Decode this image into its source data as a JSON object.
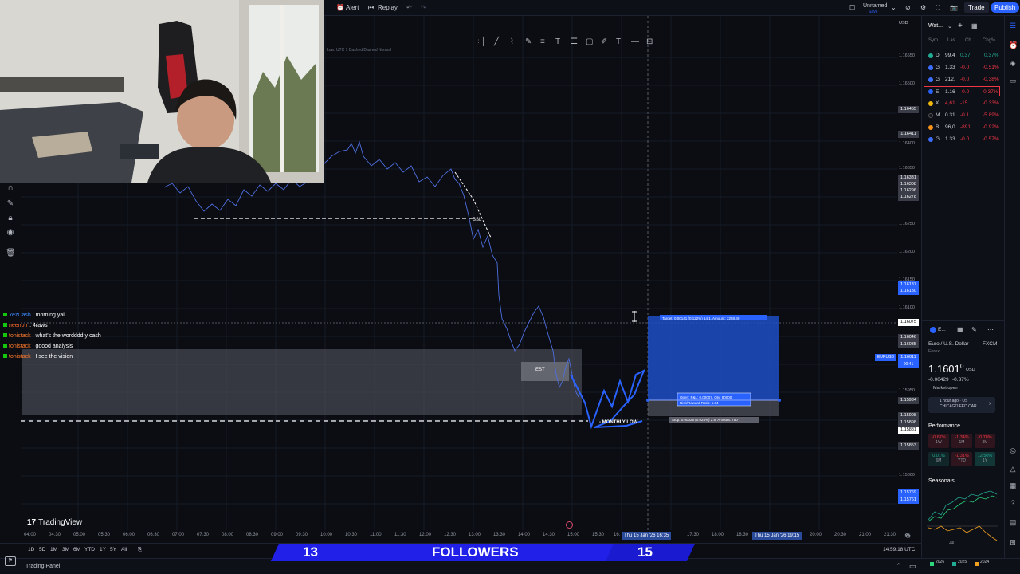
{
  "topbar": {
    "alert_label": "Alert",
    "replay_label": "Replay",
    "layout_name": "Unnamed",
    "layout_sub": "Save",
    "trade_label": "Trade",
    "publish_label": "Publish"
  },
  "chart_info": {
    "legend": "Low: UTC 1 Dashed Dashed Normal"
  },
  "drawings": {
    "bsl_label": "BSL",
    "fvg_label": "EST",
    "monthly_low_label": "- MONTHLY LOW",
    "target_label": "Target: 0.00141 (0.122%) 14.1, Amount: 2258.40",
    "open_label": "Open: P&L: 0.00007, Qty: 80000",
    "risk_reward_label": "Risk/Reward Ratio: 5.04",
    "stop_label": "Stop: 0.00028 (0.024%) 2.8, Amount: 750"
  },
  "price_axis": {
    "currency": "USD",
    "labels": [
      "1.16550",
      "1.16500",
      "1.16450",
      "1.16400",
      "1.16350",
      "1.16250",
      "1.16200",
      "1.16150",
      "1.16100",
      "1.15950",
      "1.15900",
      "1.15850",
      "1.15800"
    ],
    "tags": [
      {
        "text": "1.16455",
        "kind": "grey"
      },
      {
        "text": "1.16411",
        "kind": "grey"
      },
      {
        "text": "1.16331",
        "kind": "grey"
      },
      {
        "text": "1.16308",
        "kind": "grey"
      },
      {
        "text": "1.16296",
        "kind": "grey"
      },
      {
        "text": "1.16278",
        "kind": "grey"
      },
      {
        "text": "1.16137",
        "kind": "blue"
      },
      {
        "text": "1.16130",
        "kind": "blue"
      },
      {
        "text": "1.16075",
        "kind": "white"
      },
      {
        "text": "1.16046",
        "kind": "grey"
      },
      {
        "text": "1.16035",
        "kind": "grey"
      },
      {
        "text": "1.16011",
        "kind": "blue"
      },
      {
        "text": "1.15934",
        "kind": "grey"
      },
      {
        "text": "1.15908",
        "kind": "grey"
      },
      {
        "text": "1.15898",
        "kind": "grey"
      },
      {
        "text": "1.15881",
        "kind": "white"
      },
      {
        "text": "1.15853",
        "kind": "grey"
      },
      {
        "text": "1.15769",
        "kind": "blue"
      },
      {
        "text": "1.15761",
        "kind": "blue"
      }
    ],
    "symbol_tag": "EURUSD",
    "symbol_tag_time": "00:41"
  },
  "time_axis": {
    "labels": [
      "04:00",
      "04:30",
      "05:00",
      "05:30",
      "06:00",
      "06:30",
      "07:00",
      "07:30",
      "08:00",
      "08:30",
      "09:00",
      "09:30",
      "10:00",
      "10:30",
      "11:00",
      "11:30",
      "12:00",
      "12:30",
      "13:00",
      "13:30",
      "14:00",
      "14:30",
      "15:00",
      "15:30",
      "16:"
    ],
    "highlight_1": "Thu 15 Jan '26  16:35",
    "highlight_2": "Thu 15 Jan '26  19:15",
    "labels_right": [
      "20:00",
      "20:30",
      "21:00",
      "21:30"
    ],
    "labels_mid": [
      "17:30",
      "18:00",
      "18:30"
    ]
  },
  "bottombar": {
    "ranges": [
      "1D",
      "5D",
      "1M",
      "3M",
      "6M",
      "YTD",
      "1Y",
      "5Y",
      "All"
    ],
    "clock": "14:59:18 UTC",
    "panel_label": "Trading Panel"
  },
  "chat": [
    {
      "user": "YezCash",
      "message": "morning yall",
      "user_color": "#3d8bff"
    },
    {
      "user": "neenorr",
      "message": "4raws",
      "user_color": "#ff6a2b"
    },
    {
      "user": "tonistack",
      "message": "what's the wordddd y cash",
      "user_color": "#ff7a2b"
    },
    {
      "user": "tonistack",
      "message": "goood analysis",
      "user_color": "#ff7a2b"
    },
    {
      "user": "tonistack",
      "message": "I see the vision",
      "user_color": "#ff7a2b"
    }
  ],
  "followers": {
    "current": "13",
    "label": "FOLLOWERS",
    "goal": "15"
  },
  "watermark": "TradingView",
  "watchlist": {
    "title": "Wat...",
    "cols": [
      "Sym",
      "Las",
      "Ch",
      "Chg%"
    ],
    "rows": [
      {
        "sym": "D",
        "last": "99.4",
        "chg": "0.37",
        "pct": "0.37%",
        "dir": "pos"
      },
      {
        "sym": "G",
        "last": "1.33",
        "chg": "-0.0",
        "pct": "-0.51%",
        "dir": "neg"
      },
      {
        "sym": "G",
        "last": "212.",
        "chg": "-0.0",
        "pct": "-0.38%",
        "dir": "neg"
      },
      {
        "sym": "E",
        "last": "1.16",
        "chg": "-0.0",
        "pct": "-0.37%",
        "dir": "neg"
      },
      {
        "sym": "X",
        "last": "4,61",
        "chg": "-15.",
        "pct": "-0.33%",
        "dir": "neg"
      },
      {
        "sym": "M",
        "last": "0.31",
        "chg": "-0.1",
        "pct": "-5.89%",
        "dir": "neg"
      },
      {
        "sym": "B",
        "last": "96,0",
        "chg": "-891",
        "pct": "-0.92%",
        "dir": "neg"
      },
      {
        "sym": "G",
        "last": "1.33",
        "chg": "-0.0",
        "pct": "-0.57%",
        "dir": "neg"
      }
    ]
  },
  "details": {
    "symbol_short": "E...",
    "name": "Euro / U.S. Dollar",
    "exchange": "FXCM",
    "type": "Forex",
    "price": "1.1601",
    "price_small": "0",
    "currency": "USD",
    "change": "-0.00429",
    "change_pct": "-0.37%",
    "market_status": "Market open",
    "news_time": "1 hour ago · US",
    "news_title": "CHICAGO FED CAR...",
    "performance_title": "Performance",
    "perf": [
      {
        "v": "-0.67%",
        "p": "1W",
        "dir": "neg"
      },
      {
        "v": "-1.34%",
        "p": "1M",
        "dir": "neg"
      },
      {
        "v": "-0.78%",
        "p": "3M",
        "dir": "neg"
      },
      {
        "v": "0.01%",
        "p": "6M",
        "dir": "pos"
      },
      {
        "v": "-1.31%",
        "p": "YTD",
        "dir": "neg"
      },
      {
        "v": "12.50%",
        "p": "1Y",
        "dir": "pos"
      }
    ],
    "seasonals_title": "Seasonals",
    "seasonals_month": "Jul",
    "seasonal_years": [
      "2026",
      "2025",
      "2024"
    ]
  }
}
